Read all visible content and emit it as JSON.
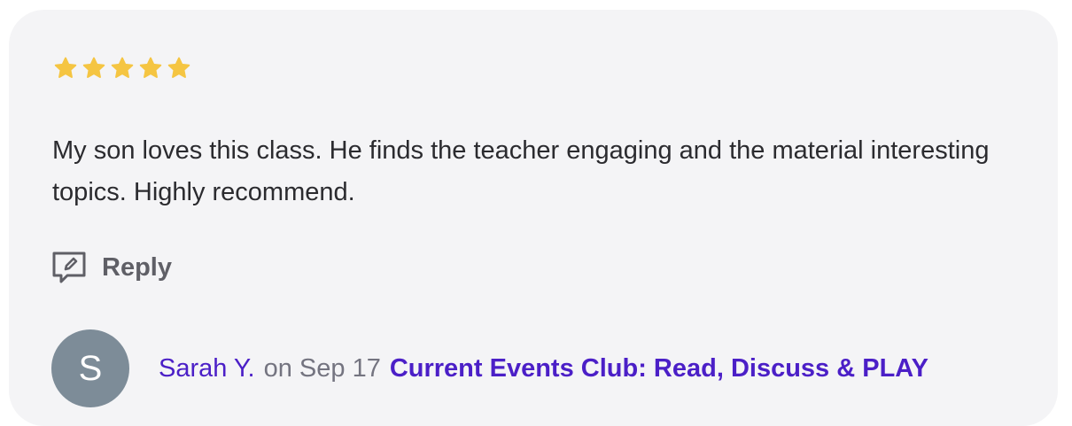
{
  "review": {
    "rating": 5,
    "max_rating": 5,
    "star_color": "#f5c542",
    "text": "My son loves this class. He finds the teacher engaging and the material interesting topics. Highly recommend.",
    "reply_label": "Reply"
  },
  "author": {
    "initial": "S",
    "name": "Sarah Y.",
    "date_text": "on Sep 17",
    "avatar_color": "#7d8c98"
  },
  "class_link": {
    "label": "Current Events Club: Read, Discuss & PLAY",
    "color": "#4b1fc7"
  },
  "icons": {
    "rating": "star-icon",
    "reply": "reply-comment-icon"
  }
}
